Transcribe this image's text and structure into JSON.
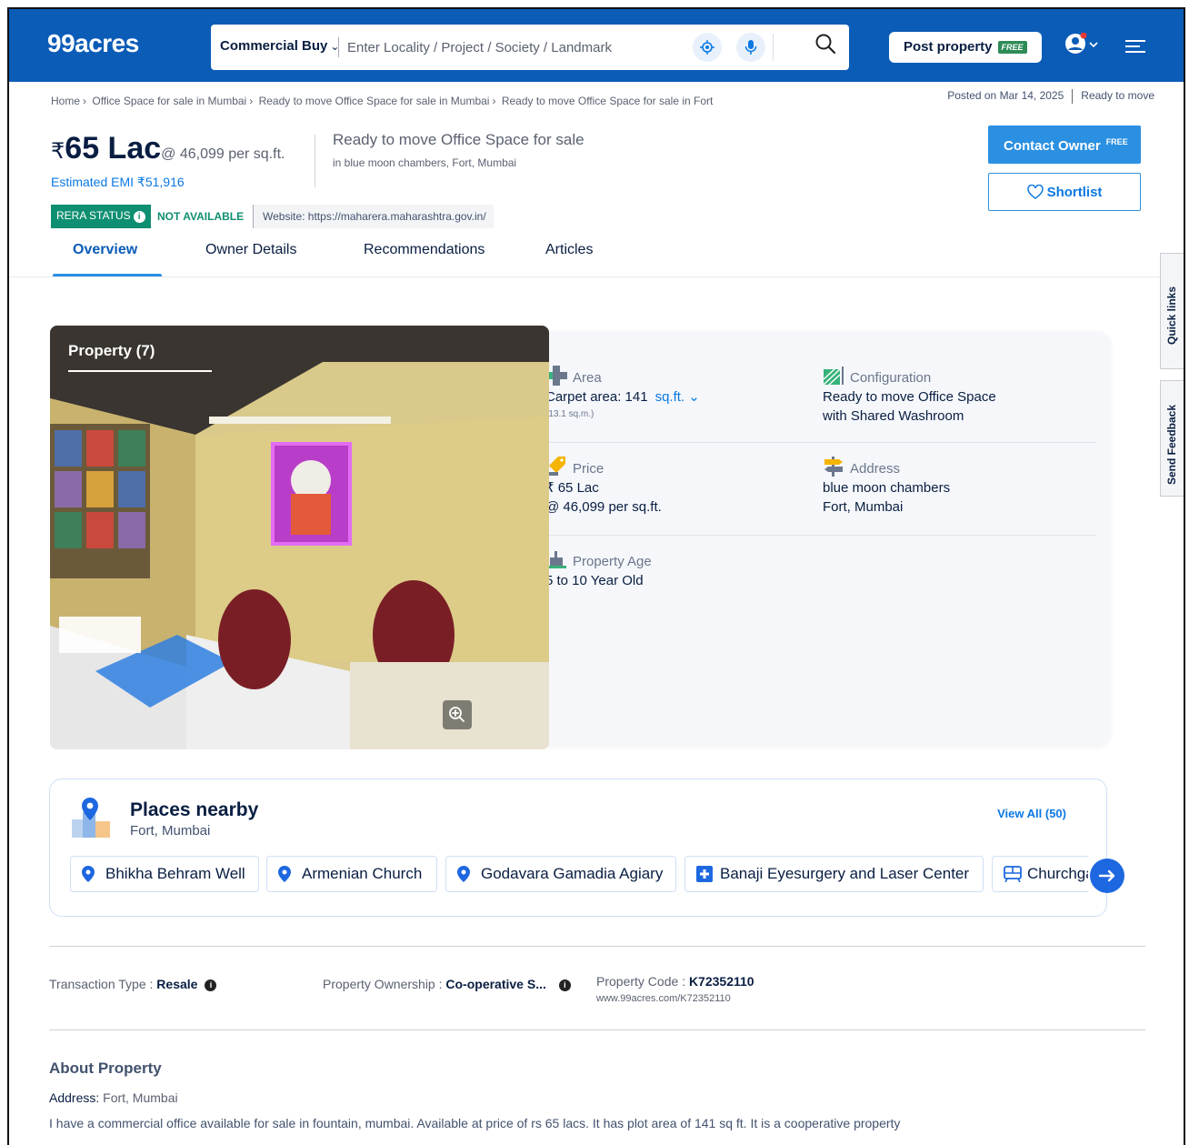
{
  "header": {
    "logo": "99acres",
    "search_type": "Commercial Buy",
    "search_placeholder": "Enter Locality / Project / Society / Landmark",
    "post_property_label": "Post property",
    "post_property_badge": "FREE"
  },
  "breadcrumb": [
    "Home",
    "Office Space for sale in Mumbai",
    "Ready to move Office Space for sale in Mumbai",
    "Ready to move Office Space for sale in Fort"
  ],
  "posted": {
    "date": "Posted on Mar 14, 2025",
    "status": "Ready to move"
  },
  "listing": {
    "currency": "₹",
    "price": "65 Lac",
    "per_sqft": "@ 46,099 per sq.ft.",
    "emi": "Estimated EMI ₹51,916",
    "title": "Ready to move Office Space for sale",
    "subtitle": "in blue moon chambers, Fort, Mumbai",
    "rera_label": "RERA STATUS",
    "rera_value": "NOT AVAILABLE",
    "rera_website": "Website: https://maharera.maharashtra.gov.in/"
  },
  "actions": {
    "contact": "Contact Owner",
    "contact_badge": "FREE",
    "shortlist": "Shortlist"
  },
  "tabs": [
    "Overview",
    "Owner Details",
    "Recommendations",
    "Articles"
  ],
  "side_tabs": [
    "Quick links",
    "Send Feedback"
  ],
  "photo": {
    "label": "Property (7)"
  },
  "details": {
    "area_label": "Area",
    "area_value": "Carpet area: 141",
    "area_unit": "sq.ft.",
    "area_sub": "(13.1 sq.m.)",
    "config_label": "Configuration",
    "config_line1": "Ready to move Office Space",
    "config_line2": "with Shared Washroom",
    "price_label": "Price",
    "price_line1": "₹ 65 Lac",
    "price_line2": "@ 46,099 per sq.ft.",
    "address_label": "Address",
    "address_line1": "blue moon chambers",
    "address_line2": "Fort, Mumbai",
    "age_label": "Property Age",
    "age_value": "5 to 10 Year Old"
  },
  "places": {
    "title": "Places nearby",
    "location": "Fort, Mumbai",
    "view_all": "View All (50)",
    "chips": [
      "Bhikha Behram Well",
      "Armenian Church",
      "Godavara Gamadia Agiary",
      "Banaji Eyesurgery and Laser Center",
      "Churchgate"
    ]
  },
  "facts": {
    "transaction_label": "Transaction Type : ",
    "transaction_value": "Resale",
    "ownership_label": "Property Ownership : ",
    "ownership_value": "Co-operative S...",
    "code_label": "Property Code : ",
    "code_value": "K72352110",
    "code_url": "www.99acres.com/K72352110"
  },
  "about": {
    "heading": "About Property",
    "address_label": "Address: ",
    "address_value": "Fort, Mumbai",
    "description": "I have a commercial office available for sale in fountain, mumbai. Available at price of rs 65 lacs. It has plot area of 141 sq ft. It is a cooperative property"
  },
  "colors": {
    "brand": "#0b5cb7",
    "accent": "#2b90e2",
    "rera": "#0f8f72"
  }
}
